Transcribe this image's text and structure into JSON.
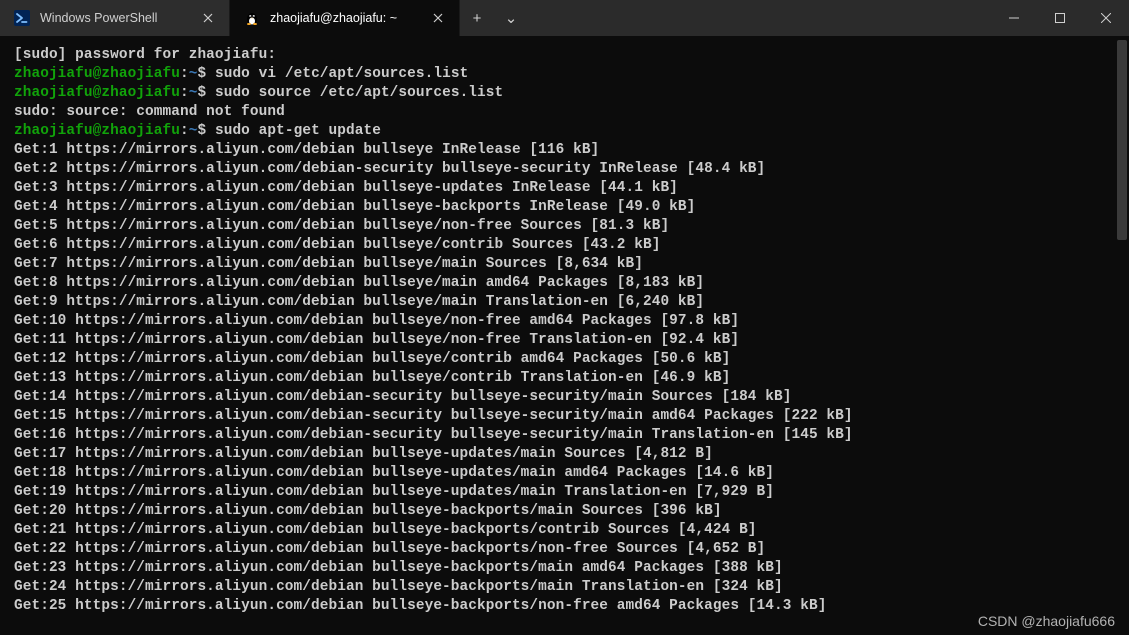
{
  "titlebar": {
    "tabs": [
      {
        "icon": "powershell-icon",
        "title": "Windows PowerShell",
        "active": false
      },
      {
        "icon": "tux-icon",
        "title": "zhaojiafu@zhaojiafu: ~",
        "active": true
      }
    ],
    "newtab_glyph": "+",
    "dropdown_glyph": "⌄"
  },
  "prompt": {
    "user_host": "zhaojiafu@zhaojiafu",
    "path": "~",
    "sigil": "$"
  },
  "lines": [
    {
      "t": "plain",
      "text": "[sudo] password for zhaojiafu:"
    },
    {
      "t": "prompt",
      "cmd": "sudo vi /etc/apt/sources.list"
    },
    {
      "t": "prompt",
      "cmd": "sudo source /etc/apt/sources.list"
    },
    {
      "t": "plain",
      "text": "sudo: source: command not found"
    },
    {
      "t": "prompt",
      "cmd": "sudo apt-get update"
    },
    {
      "t": "plain",
      "text": "Get:1 https://mirrors.aliyun.com/debian bullseye InRelease [116 kB]"
    },
    {
      "t": "plain",
      "text": "Get:2 https://mirrors.aliyun.com/debian-security bullseye-security InRelease [48.4 kB]"
    },
    {
      "t": "plain",
      "text": "Get:3 https://mirrors.aliyun.com/debian bullseye-updates InRelease [44.1 kB]"
    },
    {
      "t": "plain",
      "text": "Get:4 https://mirrors.aliyun.com/debian bullseye-backports InRelease [49.0 kB]"
    },
    {
      "t": "plain",
      "text": "Get:5 https://mirrors.aliyun.com/debian bullseye/non-free Sources [81.3 kB]"
    },
    {
      "t": "plain",
      "text": "Get:6 https://mirrors.aliyun.com/debian bullseye/contrib Sources [43.2 kB]"
    },
    {
      "t": "plain",
      "text": "Get:7 https://mirrors.aliyun.com/debian bullseye/main Sources [8,634 kB]"
    },
    {
      "t": "plain",
      "text": "Get:8 https://mirrors.aliyun.com/debian bullseye/main amd64 Packages [8,183 kB]"
    },
    {
      "t": "plain",
      "text": "Get:9 https://mirrors.aliyun.com/debian bullseye/main Translation-en [6,240 kB]"
    },
    {
      "t": "plain",
      "text": "Get:10 https://mirrors.aliyun.com/debian bullseye/non-free amd64 Packages [97.8 kB]"
    },
    {
      "t": "plain",
      "text": "Get:11 https://mirrors.aliyun.com/debian bullseye/non-free Translation-en [92.4 kB]"
    },
    {
      "t": "plain",
      "text": "Get:12 https://mirrors.aliyun.com/debian bullseye/contrib amd64 Packages [50.6 kB]"
    },
    {
      "t": "plain",
      "text": "Get:13 https://mirrors.aliyun.com/debian bullseye/contrib Translation-en [46.9 kB]"
    },
    {
      "t": "plain",
      "text": "Get:14 https://mirrors.aliyun.com/debian-security bullseye-security/main Sources [184 kB]"
    },
    {
      "t": "plain",
      "text": "Get:15 https://mirrors.aliyun.com/debian-security bullseye-security/main amd64 Packages [222 kB]"
    },
    {
      "t": "plain",
      "text": "Get:16 https://mirrors.aliyun.com/debian-security bullseye-security/main Translation-en [145 kB]"
    },
    {
      "t": "plain",
      "text": "Get:17 https://mirrors.aliyun.com/debian bullseye-updates/main Sources [4,812 B]"
    },
    {
      "t": "plain",
      "text": "Get:18 https://mirrors.aliyun.com/debian bullseye-updates/main amd64 Packages [14.6 kB]"
    },
    {
      "t": "plain",
      "text": "Get:19 https://mirrors.aliyun.com/debian bullseye-updates/main Translation-en [7,929 B]"
    },
    {
      "t": "plain",
      "text": "Get:20 https://mirrors.aliyun.com/debian bullseye-backports/main Sources [396 kB]"
    },
    {
      "t": "plain",
      "text": "Get:21 https://mirrors.aliyun.com/debian bullseye-backports/contrib Sources [4,424 B]"
    },
    {
      "t": "plain",
      "text": "Get:22 https://mirrors.aliyun.com/debian bullseye-backports/non-free Sources [4,652 B]"
    },
    {
      "t": "plain",
      "text": "Get:23 https://mirrors.aliyun.com/debian bullseye-backports/main amd64 Packages [388 kB]"
    },
    {
      "t": "plain",
      "text": "Get:24 https://mirrors.aliyun.com/debian bullseye-backports/main Translation-en [324 kB]"
    },
    {
      "t": "plain",
      "text": "Get:25 https://mirrors.aliyun.com/debian bullseye-backports/non-free amd64 Packages [14.3 kB]"
    }
  ],
  "watermark": "CSDN @zhaojiafu666"
}
